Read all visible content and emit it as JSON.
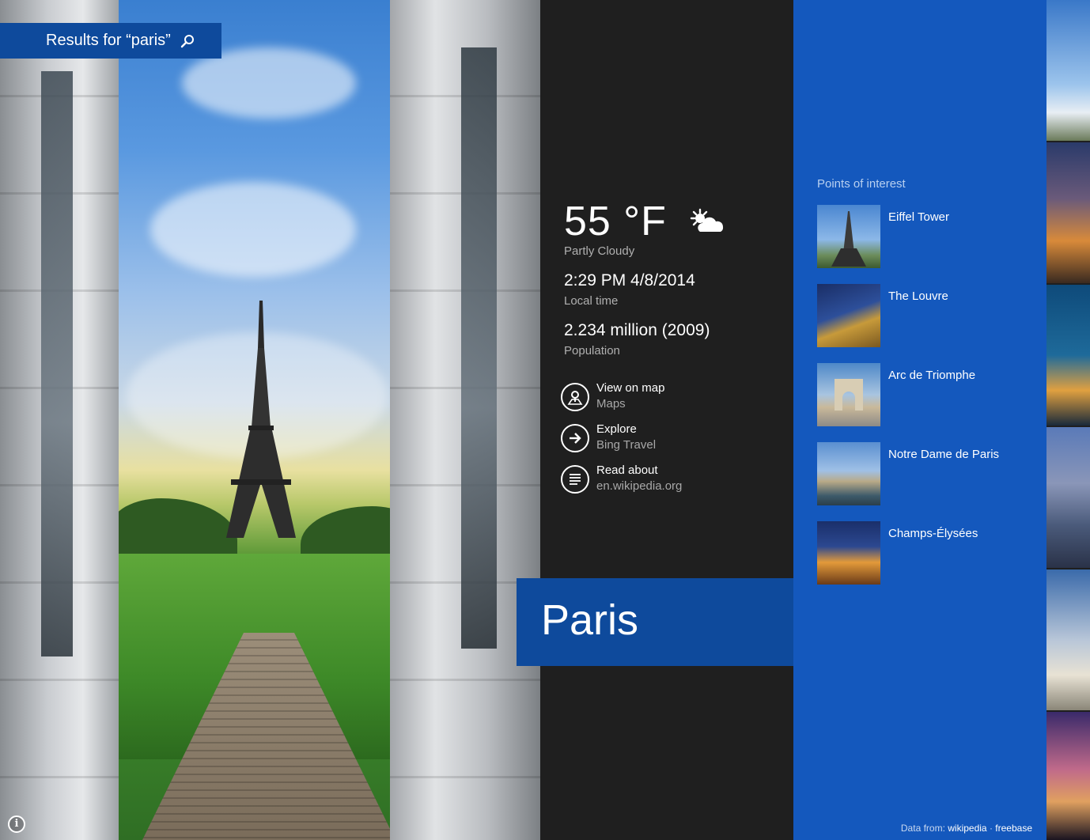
{
  "search": {
    "results_label": "Results for “paris”"
  },
  "weather": {
    "temperature": "55 °F",
    "condition": "Partly Cloudy"
  },
  "local_time": {
    "value": "2:29 PM 4/8/2014",
    "label": "Local time"
  },
  "population": {
    "value": "2.234 million (2009)",
    "label": "Population"
  },
  "actions": [
    {
      "label": "View on map",
      "sub": "Maps"
    },
    {
      "label": "Explore",
      "sub": "Bing Travel"
    },
    {
      "label": "Read about",
      "sub": "en.wikipedia.org"
    }
  ],
  "city": {
    "name": "Paris"
  },
  "points_of_interest": {
    "heading": "Points of interest",
    "items": [
      {
        "name": "Eiffel Tower"
      },
      {
        "name": "The Louvre"
      },
      {
        "name": "Arc de Triomphe"
      },
      {
        "name": "Notre Dame de Paris"
      },
      {
        "name": "Champs-Élysées"
      }
    ]
  },
  "footer": {
    "prefix": "Data from:",
    "source_1": "wikipedia",
    "separator": "·",
    "source_2": "freebase"
  },
  "colors": {
    "accent_blue": "#1458bd",
    "title_blue": "#0e4a9c",
    "panel_dark": "#1f1f1f"
  }
}
